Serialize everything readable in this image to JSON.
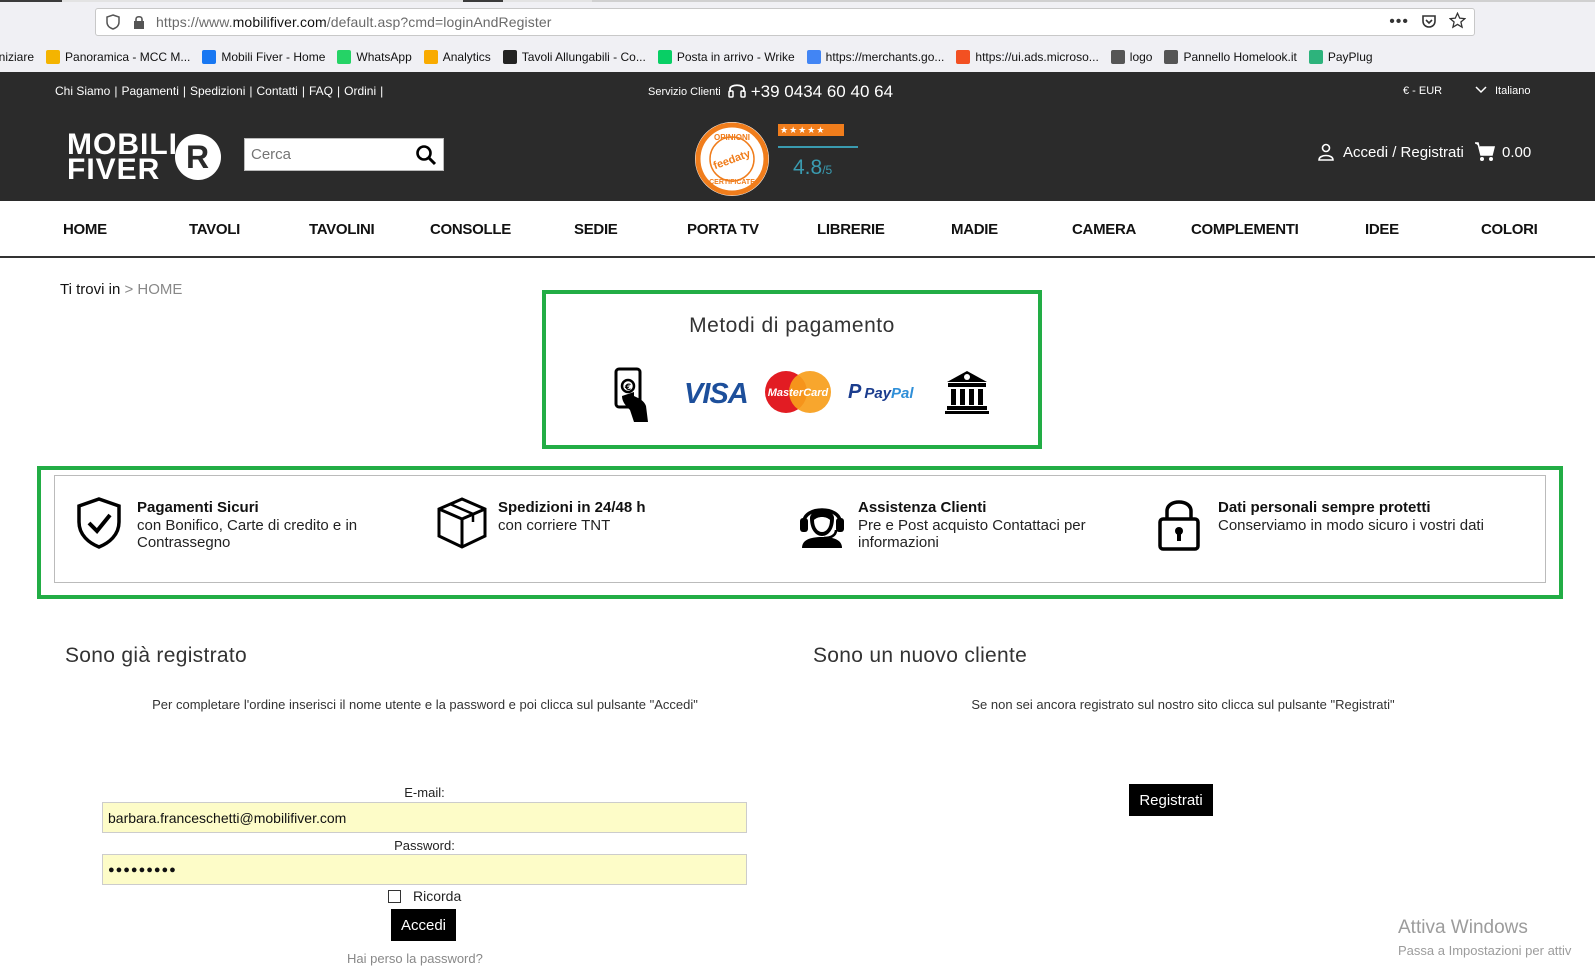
{
  "browser": {
    "url_prefix": "https://www.",
    "url_domain": "mobilifiver.com",
    "url_path": "/default.asp?cmd=loginAndRegister",
    "bookmarks": [
      {
        "label": "iniziare",
        "color": ""
      },
      {
        "label": "Panoramica - MCC M...",
        "color": "#f4b400"
      },
      {
        "label": "Mobili Fiver - Home",
        "color": "#1877f2"
      },
      {
        "label": "WhatsApp",
        "color": "#25d366"
      },
      {
        "label": "Analytics",
        "color": "#f9ab00"
      },
      {
        "label": "Tavoli Allungabili - Co...",
        "color": "#222222"
      },
      {
        "label": "Posta in arrivo - Wrike",
        "color": "#08cf65"
      },
      {
        "label": "https://merchants.go...",
        "color": "#4285f4"
      },
      {
        "label": "https://ui.ads.microso...",
        "color": "#f25022"
      },
      {
        "label": "logo",
        "color": "#555555"
      },
      {
        "label": "Pannello Homelook.it",
        "color": "#555555"
      },
      {
        "label": "PayPlug",
        "color": "#2db37c"
      }
    ]
  },
  "topbar": {
    "links": [
      "Chi Siamo",
      "Pagamenti",
      "Spedizioni",
      "Contatti",
      "FAQ",
      "Ordini"
    ],
    "service_label": "Servizio Clienti",
    "phone": "+39 0434 60 40 64",
    "currency": "€ - EUR",
    "language": "Italiano"
  },
  "header": {
    "logo_line1": "MOBILI",
    "logo_line2": "FIVER",
    "logo_mark": "R",
    "search_placeholder": "Cerca",
    "badge_top": "OPINIONI",
    "badge_mid": "feedaty",
    "badge_bottom": "CERTIFICATE",
    "rating_score": "4.8",
    "rating_max": "/5",
    "account_label": "Accedi / Registrati",
    "cart_total": "0.00"
  },
  "nav": [
    "HOME",
    "TAVOLI",
    "TAVOLINI",
    "CONSOLLE",
    "SEDIE",
    "PORTA TV",
    "LIBRERIE",
    "MADIE",
    "CAMERA",
    "COMPLEMENTI",
    "IDEE",
    "COLORI"
  ],
  "breadcrumb": {
    "prefix": "Ti trovi in",
    "rest": "> HOME"
  },
  "payments": {
    "title": "Metodi di pagamento",
    "visa": "VISA",
    "mastercard": "MasterCard",
    "paypal_a": "Pay",
    "paypal_b": "Pal"
  },
  "features": [
    {
      "title": "Pagamenti Sicuri",
      "desc": "con Bonifico, Carte di credito e in Contrassegno",
      "icon": "shield-check-icon"
    },
    {
      "title": "Spedizioni in 24/48 h",
      "desc": "con corriere TNT",
      "icon": "box-icon"
    },
    {
      "title": "Assistenza Clienti",
      "desc": "Pre e Post acquisto Contattaci per informazioni",
      "icon": "support-agent-icon"
    },
    {
      "title": "Dati personali sempre protetti",
      "desc": "Conserviamo in modo sicuro i vostri dati",
      "icon": "padlock-icon"
    }
  ],
  "login": {
    "heading": "Sono già registrato",
    "instructions": "Per completare l'ordine inserisci il nome utente e la password e poi clicca sul pulsante \"Accedi\"",
    "email_label": "E-mail:",
    "email_value": "barbara.franceschetti@mobilifiver.com",
    "password_label": "Password:",
    "password_value": "●●●●●●●●●",
    "remember_label": "Ricorda",
    "submit": "Accedi",
    "forgot": "Hai perso la password?"
  },
  "register": {
    "heading": "Sono un nuovo cliente",
    "instructions": "Se non sei ancora registrato sul nostro sito clicca sul pulsante \"Registrati\"",
    "submit": "Registrati"
  },
  "watermark": {
    "line1": "Attiva Windows",
    "line2": "Passa a Impostazioni per attiv"
  }
}
